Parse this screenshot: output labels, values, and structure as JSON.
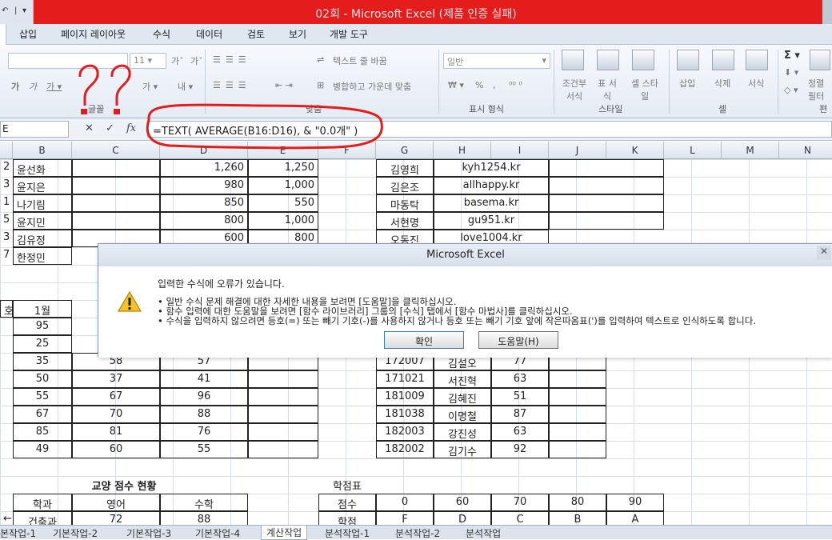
{
  "window": {
    "title": "02회 - Microsoft Excel (제품 인증 실패)"
  },
  "tabs": [
    "삽입",
    "페이지 레이아웃",
    "수식",
    "데이터",
    "검토",
    "보기",
    "개발 도구"
  ],
  "ribbon": {
    "font_size": "11",
    "font_group_label": "글꼴",
    "align_group_label": "맞춤",
    "wrap_text": "텍스트 줄 바꿈",
    "merge_center": "병합하고 가운데 맞춤",
    "number_format": "일반",
    "number_group_label": "표시 형식",
    "cond_format": "조건부 서식",
    "table_format": "표 서식",
    "cell_style": "셀 스타일",
    "style_group_label": "스타일",
    "insert": "삽입",
    "delete": "삭제",
    "format": "서식",
    "cell_group_label": "셀",
    "sort": "정렬 필터",
    "edit_group_label": "편"
  },
  "formula_bar": {
    "name_box": "E",
    "formula": "=TEXT( AVERAGE(B16:D16), & \"0.0개\" )"
  },
  "columns": [
    "B",
    "C",
    "D",
    "E",
    "F",
    "G",
    "H",
    "I",
    "J",
    "K",
    "L",
    "M",
    "N"
  ],
  "sheet": {
    "top_rows": [
      {
        "a": "2",
        "b": "윤선화",
        "d": "1,260",
        "e": "1,250",
        "g": "김영희",
        "h": "kyh1254.kr"
      },
      {
        "a": "3",
        "b": "윤지은",
        "d": "980",
        "e": "1,000",
        "g": "김은조",
        "h": "allhappy.kr"
      },
      {
        "a": "1",
        "b": "나기림",
        "d": "850",
        "e": "550",
        "g": "마동탁",
        "h": "basema.kr"
      },
      {
        "a": "5",
        "b": "윤지민",
        "d": "800",
        "e": "1,000",
        "g": "서현명",
        "h": "gu951.kr"
      },
      {
        "a": "3",
        "b": "김유정",
        "d": "600",
        "e": "800",
        "g": "오동진",
        "h": "love1004.kr"
      },
      {
        "a": "7",
        "b": "한정민"
      }
    ],
    "mid_header": {
      "a": "호",
      "b": "1월"
    },
    "mid_rows": [
      {
        "b": "95"
      },
      {
        "b": "25"
      },
      {
        "b": "35",
        "c": "58",
        "d": "57",
        "g": "172007",
        "h": "김설오",
        "i": "77"
      },
      {
        "b": "50",
        "c": "37",
        "d": "41",
        "g": "171021",
        "h": "서진혁",
        "i": "63"
      },
      {
        "b": "55",
        "c": "67",
        "d": "96",
        "g": "181009",
        "h": "김혜진",
        "i": "51"
      },
      {
        "b": "67",
        "c": "70",
        "d": "88",
        "g": "181038",
        "h": "이명철",
        "i": "87"
      },
      {
        "b": "85",
        "c": "81",
        "d": "76",
        "g": "182003",
        "h": "강진성",
        "i": "63"
      },
      {
        "b": "49",
        "c": "60",
        "d": "55",
        "g": "182002",
        "h": "김기수",
        "i": "92"
      }
    ],
    "bottom": {
      "title1": "교양 점수 현황",
      "title2": "학점표",
      "header": {
        "b": "학과",
        "c": "영어",
        "d": "수학",
        "f": "점수",
        "g": "0",
        "h": "60",
        "i": "70",
        "j": "80",
        "k": "90"
      },
      "row": {
        "a": "←",
        "b": "건축과",
        "c": "72",
        "d": "88",
        "f": "학점",
        "g": "F",
        "h": "D",
        "i": "C",
        "j": "B",
        "k": "A"
      }
    }
  },
  "sheet_tabs": [
    "본작업-1",
    "기본작업-2",
    "기본작업-3",
    "기본작업-4",
    "계산작업",
    "분석작업-1",
    "분석작업-2",
    "분석작업"
  ],
  "active_sheet": "계산작업",
  "dialog": {
    "title": "Microsoft Excel",
    "message": "입력한 수식에 오류가 있습니다.",
    "bullets": [
      "• 일반 수식 문제 해결에 대한 자세한 내용을 보려면 [도움말]을 클릭하십시오.",
      "• 함수 입력에 대한 도움말을 보려면 [함수 라이브러리] 그룹의 [수식] 탭에서 [함수 마법사]를 클릭하십시오.",
      "• 수식을 입력하지 않으려면 등호(=) 또는 빼기 기호(-)를 사용하지 않거나 등호 또는 빼기 기호 앞에 작은따옴표(')를 입력하여 텍스트로 인식하도록 합니다."
    ],
    "ok_label": "확인",
    "help_label": "도움말(H)"
  }
}
